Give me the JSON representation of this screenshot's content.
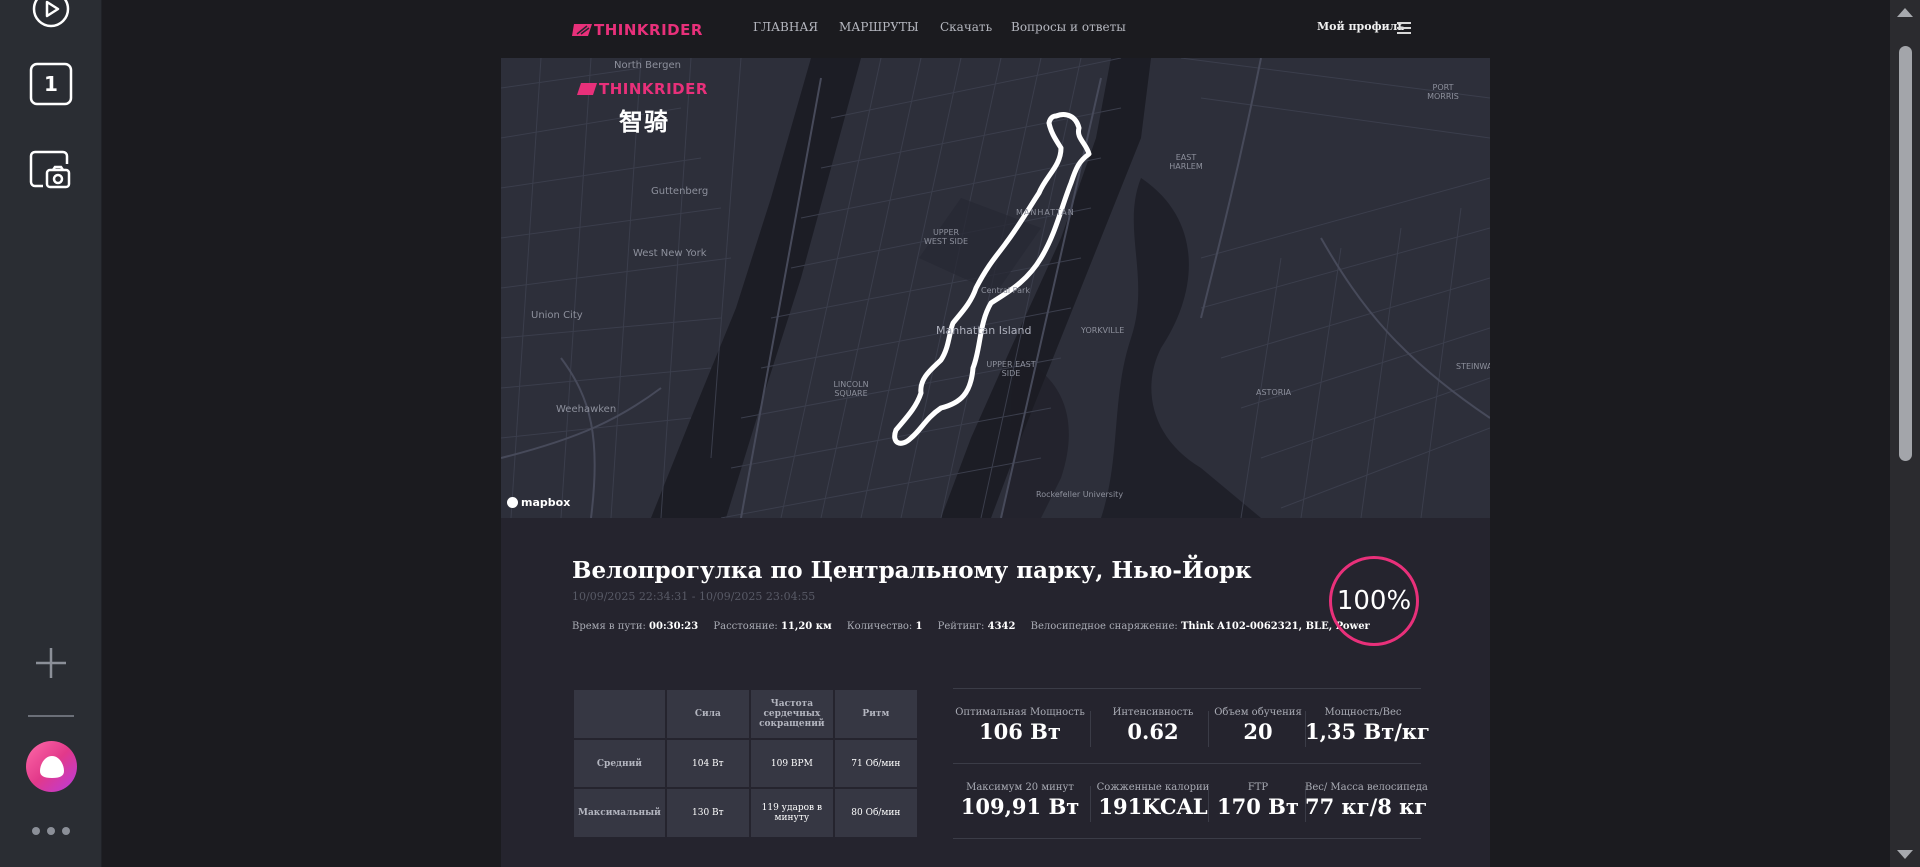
{
  "sidebar": {
    "play_icon": "play-circle-icon",
    "counter_label": "1",
    "add_icon": "plus-icon",
    "more_icon": "ellipsis-icon"
  },
  "nav": {
    "logo_text": "THINKRIDER",
    "links": [
      "ГЛАВНАЯ",
      "МАРШРУТЫ",
      "Скачать",
      "Вопросы и ответы"
    ],
    "profile": "Мой профиль"
  },
  "map": {
    "logo_text": "THINKRIDER",
    "logo_cn": "智骑",
    "attribution": "mapbox",
    "labels": {
      "north_bergen": "North Bergen",
      "guttenberg": "Guttenberg",
      "west_new_york": "West New York",
      "union_city": "Union City",
      "weehawken": "Weehawken",
      "manhattan": "Manhattan Island",
      "central_park": "Central Park",
      "manhattan_n": "MANHATTAN",
      "east_harlem": "EAST HARLEM",
      "upper_west": "UPPER WEST SIDE",
      "upper_east": "UPPER EAST SIDE",
      "yorkville": "YORKVILLE",
      "lincoln_sq": "LINCOLN SQUARE",
      "astoria": "ASTORIA",
      "steinway": "STEINWAY",
      "port_morris": "PORT MORRIS",
      "rockefeller": "Rockefeller University"
    }
  },
  "ride": {
    "title": "Велопрогулка по Центральному парку, Нью-Йорк",
    "date_range": "10/09/2025 22:34:31 - 10/09/2025 23:04:55",
    "meta": {
      "time_label": "Время в пути:",
      "time_value": "00:30:23",
      "distance_label": "Расстояние:",
      "distance_value": "11,20 км",
      "count_label": "Количество:",
      "count_value": "1",
      "rating_label": "Рейтинг:",
      "rating_value": "4342",
      "equipment_label": "Велосипедное снаряжение:",
      "equipment_value": "Think A102-0062321, BLE, Power"
    },
    "completion": "100%"
  },
  "stats_table": {
    "headers": [
      "",
      "Сила",
      "Частота сердечных сокращений",
      "Ритм"
    ],
    "rows": [
      {
        "label": "Средний",
        "power": "104 Вт",
        "hr": "109 BPM",
        "cadence": "71 Об/мин"
      },
      {
        "label": "Максимальный",
        "power": "130 Вт",
        "hr": "119 ударов в минуту",
        "cadence": "80 Об/мин"
      }
    ]
  },
  "metrics": {
    "row1": [
      {
        "label": "Оптимальная Мощность",
        "value": "106 Вт"
      },
      {
        "label": "Интенсивность",
        "value": "0.62"
      },
      {
        "label": "Объем обучения",
        "value": "20"
      },
      {
        "label": "Мощность/Вес",
        "value": "1,35 Вт/кг"
      }
    ],
    "row2": [
      {
        "label": "Максимум 20 минут",
        "value": "109,91 Вт"
      },
      {
        "label": "Сожженные калории",
        "value": "191KCAL"
      },
      {
        "label": "FTP",
        "value": "170 Вт"
      },
      {
        "label": "Вес/ Масса велосипеда",
        "value": "77 кг/8 кг"
      }
    ]
  },
  "colors": {
    "brand": "#e8307a",
    "map_bg": "#2d2f3a",
    "panel_bg": "#25242e"
  }
}
